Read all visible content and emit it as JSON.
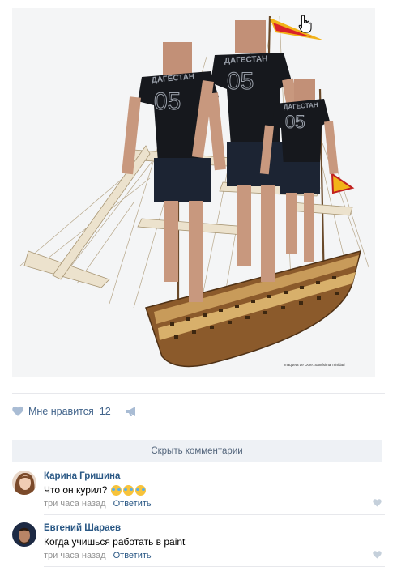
{
  "post": {
    "image_caption": "maqueta de Ocre: Santísima Trinidad",
    "shirt_text": "ДАГЕСТАН",
    "shirt_number": "05"
  },
  "actions": {
    "like_label": "Мне нравится",
    "like_count": "12"
  },
  "comments_toggle": "Скрыть комментарии",
  "comments": [
    {
      "author": "Карина Гришина",
      "text": "Что он курил?",
      "emojis": 3,
      "time": "три часа назад",
      "reply_label": "Ответить"
    },
    {
      "author": "Евгений Шараев",
      "text": "Когда учишься работать в paint",
      "time": "три часа назад",
      "reply_label": "Ответить"
    }
  ],
  "colors": {
    "link": "#2a5885",
    "muted": "#939393",
    "button_bg": "#eef1f5",
    "like_icon": "#a9bcd4"
  }
}
